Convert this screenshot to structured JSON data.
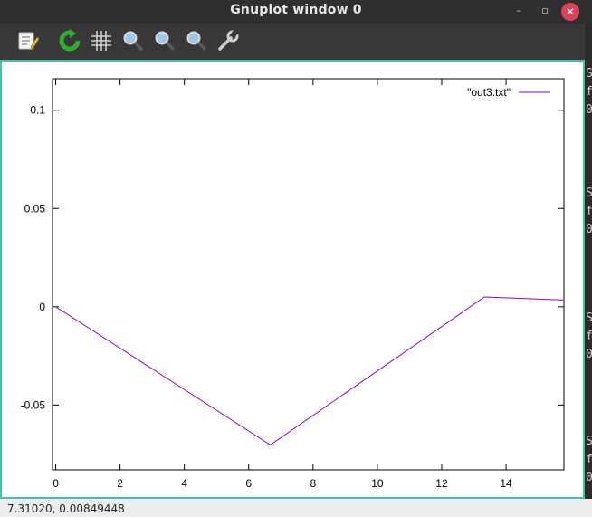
{
  "window": {
    "title": "Gnuplot window 0",
    "minimize": "–",
    "maximize": "▫",
    "close": "✕"
  },
  "toolbar": {
    "buttons": [
      {
        "name": "copy-to-clipboard-button",
        "icon": "clipboard-icon"
      },
      {
        "name": "replot-button",
        "icon": "replot-icon"
      },
      {
        "name": "grid-button",
        "icon": "grid-icon"
      },
      {
        "name": "zoom-back-button",
        "icon": "zoom-back-icon"
      },
      {
        "name": "zoom-forward-button",
        "icon": "zoom-forward-icon"
      },
      {
        "name": "autoscale-button",
        "icon": "autoscale-icon"
      },
      {
        "name": "configure-button",
        "icon": "wrench-icon"
      }
    ]
  },
  "status": {
    "text": "7.31020,  0.00849448"
  },
  "background_terminal": {
    "fragments": [
      "S",
      "f",
      "0",
      "S",
      "f",
      "0",
      "S",
      "f",
      "0",
      "S",
      "f",
      "0"
    ]
  },
  "colors": {
    "accent": "#3ec6a7",
    "series": "#9400d3",
    "close": "#e0415a"
  },
  "chart_data": {
    "type": "line",
    "title": "",
    "xlabel": "",
    "ylabel": "",
    "xlim": [
      -0.1,
      15.8
    ],
    "ylim": [
      -0.083,
      0.116
    ],
    "xticks": [
      0,
      2,
      4,
      6,
      8,
      10,
      12,
      14
    ],
    "xtick_labels": [
      "0",
      "2",
      "4",
      "6",
      "8",
      "10",
      "12",
      "14"
    ],
    "yticks": [
      -0.05,
      0,
      0.05,
      0.1
    ],
    "ytick_labels": [
      "-0.05",
      "0",
      "0.05",
      "0.1"
    ],
    "grid": false,
    "legend": "top-right",
    "series": [
      {
        "name": "\"out3.txt\"",
        "color": "#9400d3",
        "x": [
          0,
          6.67,
          13.33,
          15.8
        ],
        "y": [
          0.0,
          -0.0703,
          0.005,
          0.0034
        ]
      }
    ]
  }
}
